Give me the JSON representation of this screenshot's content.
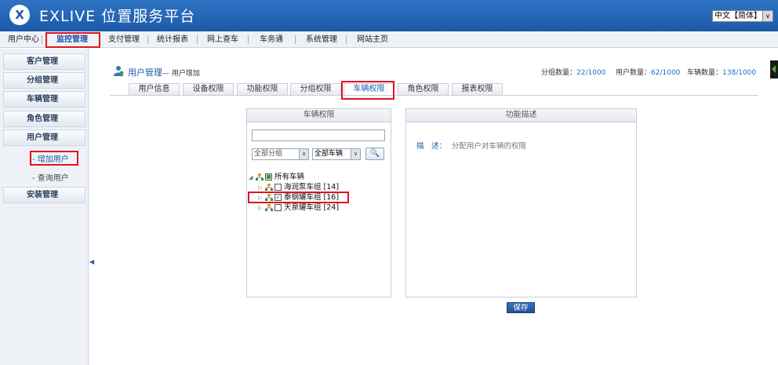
{
  "header": {
    "logo_text": "X",
    "title": "EXLIVE 位置服务平台",
    "language": "中文【简体】",
    "language_dropdown": "∨"
  },
  "topnav": {
    "items": [
      "用户中心",
      "监控管理",
      "支付管理",
      "统计报表",
      "网上查车",
      "车务通",
      "系统管理",
      "网站主页"
    ],
    "active": "监控管理"
  },
  "sidebar": {
    "items": [
      "客户管理",
      "分组管理",
      "车辆管理",
      "角色管理",
      "用户管理",
      "安装管理"
    ],
    "subitems": [
      "- 增加用户",
      "- 查询用户"
    ],
    "collapse_arrow": "◀"
  },
  "breadcrumb": {
    "title": "用户管理",
    "sub": "— 用户增加"
  },
  "stats": {
    "group_label": "分组数量：",
    "group_value": "22/1000",
    "user_label": "用户数量：",
    "user_value": "62/1000",
    "vehicle_label": "车辆数量：",
    "vehicle_value": "138/1000"
  },
  "tabs": [
    "用户信息",
    "设备权限",
    "功能权限",
    "分组权限",
    "车辆权限",
    "角色权限",
    "报表权限"
  ],
  "active_tab": "车辆权限",
  "vehicle_panel": {
    "header": "车辆权限",
    "search_value": "",
    "group_select": "全部分组",
    "vehicle_select": "全部车辆",
    "dropdown_glyph": "∨",
    "search_button": "🔍",
    "tree": {
      "root": {
        "expander": "◢",
        "label": "所有车辆",
        "check": "■"
      },
      "children": [
        {
          "expander": "▷",
          "label": "海润泵车组 [14]",
          "checked": false,
          "check": ""
        },
        {
          "expander": "▷",
          "label": "泰钢罐车组 [16]",
          "checked": true,
          "check": "✓"
        },
        {
          "expander": "▷",
          "label": "天泉罐车组 [24]",
          "checked": false,
          "check": ""
        }
      ]
    }
  },
  "function_panel": {
    "header": "功能描述",
    "desc_label": "描　述：",
    "desc_text": "分配用户对车辆的权限"
  },
  "save_button": "保存",
  "colors": {
    "brand": "#1d5aa8",
    "highlight": "#e0141e",
    "checked": "#107010"
  }
}
